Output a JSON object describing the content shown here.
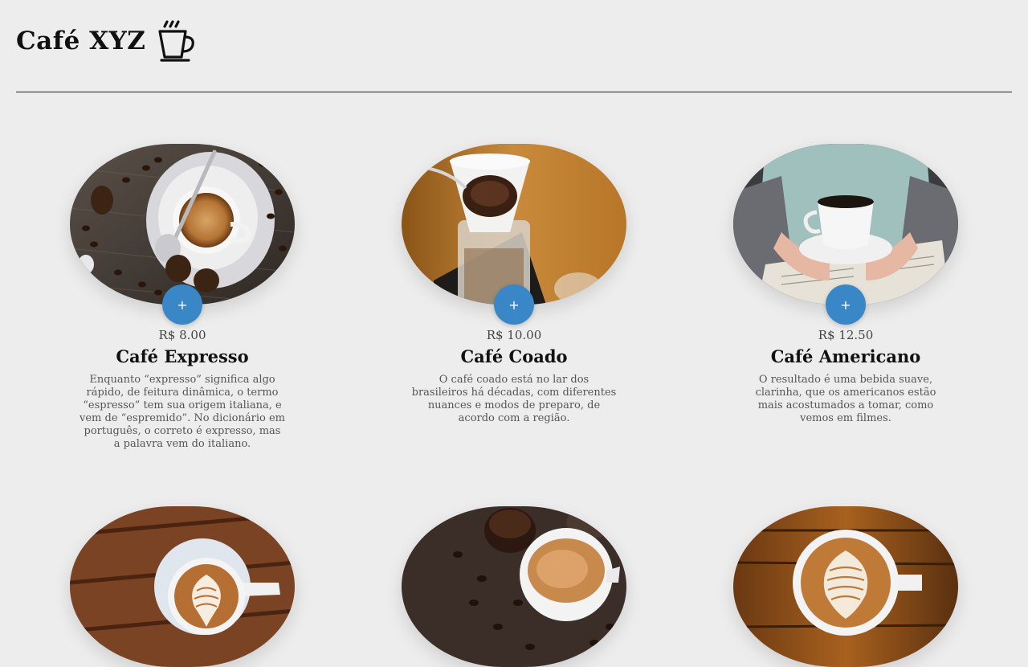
{
  "header": {
    "title": "Café XYZ",
    "icon": "coffee-cup-icon"
  },
  "colors": {
    "background": "#ededed",
    "accent": "#3a87c8"
  },
  "products": [
    {
      "price": "R$ 8.00",
      "name": "Café Expresso",
      "description": "Enquanto “expresso” significa algo rápido, de feitura dinâmica, o termo “espresso” tem sua origem italiana, e vem de “espremido”. No dicionário em português, o correto é expresso, mas a palavra vem do italiano.",
      "add_label": "+",
      "image": "espresso-photo"
    },
    {
      "price": "R$ 10.00",
      "name": "Café Coado",
      "description": "O café coado está no lar dos brasileiros há décadas, com diferentes nuances e modos de preparo, de acordo com a região.",
      "add_label": "+",
      "image": "pour-over-photo"
    },
    {
      "price": "R$ 12.50",
      "name": "Café Americano",
      "description": "O resultado é uma bebida suave, clarinha, que os americanos estão mais acostumados a tomar, como vemos em filmes.",
      "add_label": "+",
      "image": "americano-photo"
    },
    {
      "image": "latte-art-photo"
    },
    {
      "image": "cappuccino-photo"
    },
    {
      "image": "flat-white-photo"
    }
  ]
}
